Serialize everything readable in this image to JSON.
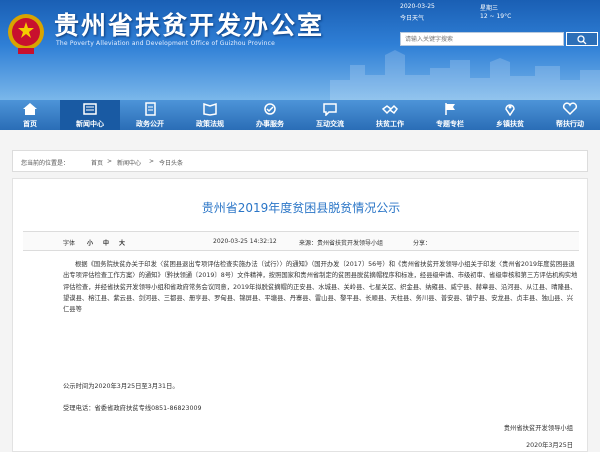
{
  "header": {
    "title": "贵州省扶贫开发办公室",
    "subtitle": "The Poverty Alleviation and Development Office of Guizhou Province",
    "date_label": "2020-03-25",
    "date_value": "星期三",
    "weather_label": "今日天气",
    "weather_value": "12 ~ 19°C",
    "search_placeholder": "请输入关键字搜索"
  },
  "nav": {
    "items": [
      {
        "label": "首页"
      },
      {
        "label": "新闻中心"
      },
      {
        "label": "政务公开"
      },
      {
        "label": "政策法规"
      },
      {
        "label": "办事服务"
      },
      {
        "label": "互动交流"
      },
      {
        "label": "扶贫工作"
      },
      {
        "label": "专题专栏"
      },
      {
        "label": "乡镇扶贫"
      },
      {
        "label": "帮扶行动"
      }
    ]
  },
  "breadcrumb": {
    "prefix": "您当前的位置是：",
    "home": "首页",
    "sep1": ">",
    "section": "新闻中心",
    "sep2": ">",
    "current": "今日头条"
  },
  "article": {
    "title": "贵州省2019年度贫困县脱贫情况公示",
    "meta": {
      "font_label": "字体",
      "font_small": "小",
      "font_medium": "中",
      "font_large": "大",
      "time_label": "2020-03-25 14:32:12",
      "source_label": "来源：贵州省扶贫开发领导小组",
      "share_label": "分享："
    },
    "paragraphs": [
      "根据《国务院扶贫办关于印发〈贫困县退出专项评估检查实施办法（试行）〉的通知》（国开办发〔2017〕56号）和《贵州省扶贫开发领导小组关于印发〈贵州省2019年度贫困县退出专项评估检查工作方案〉的通知》（黔扶领通〔2019〕8号）文件精神，按照国家和贵州省制定的贫困县脱贫摘帽程序和标准，经县级申请、市级初审、省级审核和第三方评估机构实地评估检查，并经省扶贫开发领导小组和省政府常务会议同意，2019年拟脱贫摘帽的正安县、水城县、关岭县、七星关区、织金县、纳雍县、威宁县、赫章县、沿河县、从江县、晴隆县、望谟县、榕江县、紫云县、剑河县、三都县、册亨县、罗甸县、锦屏县、平塘县、丹寨县、雷山县、黎平县、长顺县、天柱县、务川县、普安县、镇宁县、安龙县、贞丰县、独山县、兴仁县等",
      "公示时间为2020年3月25日至3月31日。",
      "受理电话：省委省政府扶贫专线0851-86823009"
    ],
    "footer_org": "贵州省扶贫开发领导小组",
    "footer_date": "2020年3月25日"
  }
}
